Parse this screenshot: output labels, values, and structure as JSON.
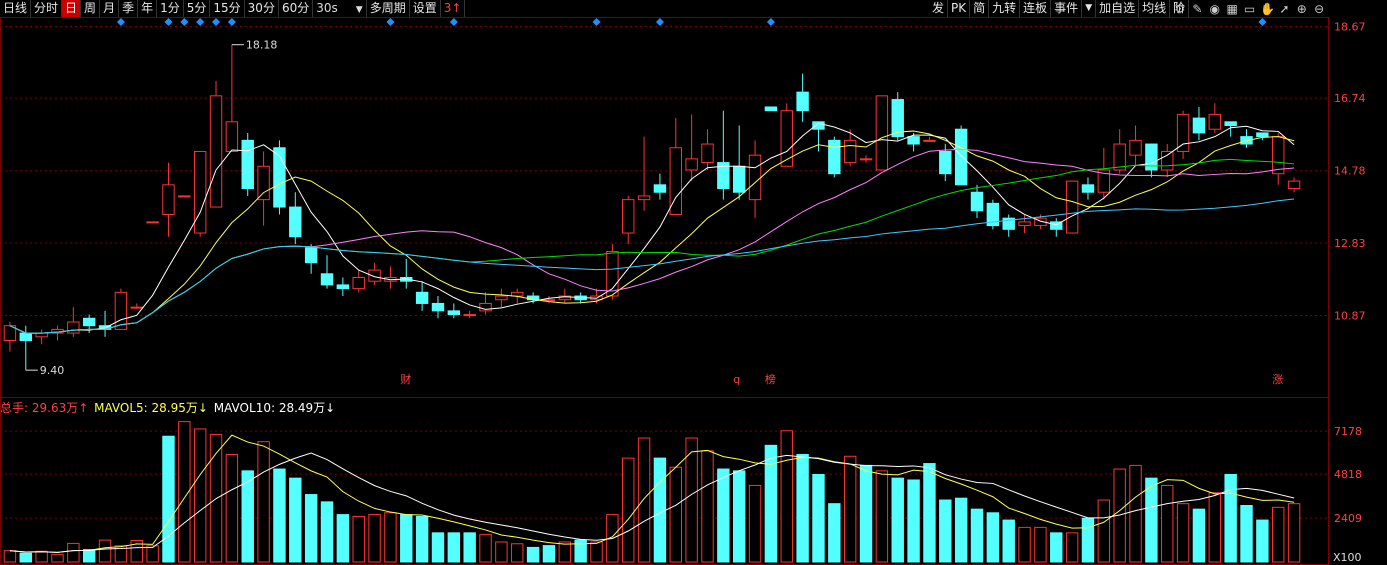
{
  "toolbar": {
    "items": [
      {
        "label": "日线",
        "state": "normal"
      },
      {
        "label": "分时",
        "state": "normal"
      },
      {
        "label": "日",
        "state": "active"
      },
      {
        "label": "周",
        "state": "normal"
      },
      {
        "label": "月",
        "state": "normal"
      },
      {
        "label": "季",
        "state": "normal"
      },
      {
        "label": "年",
        "state": "normal"
      },
      {
        "label": "1分",
        "state": "normal"
      },
      {
        "label": "5分",
        "state": "normal"
      },
      {
        "label": "15分",
        "state": "normal"
      },
      {
        "label": "30分",
        "state": "normal"
      },
      {
        "label": "60分",
        "state": "normal"
      }
    ],
    "period_select": "30s",
    "multi_period": "多周期",
    "settings": "设置",
    "alert": "3↑",
    "right_items": [
      "发",
      "PK",
      "简",
      "九转",
      "连板",
      "事件"
    ],
    "add_watch": "加自选",
    "ma_line": "均线",
    "cut_label": "阶",
    "icons": [
      "settings-icon",
      "brush-icon",
      "eye-icon",
      "calendar-icon",
      "display-icon",
      "hand-icon",
      "cursor-icon",
      "zoom-in-icon",
      "zoom-out-icon"
    ]
  },
  "price_axis": {
    "ticks": [
      "18.67",
      "16.74",
      "14.78",
      "12.83",
      "10.87"
    ]
  },
  "volume_axis": {
    "ticks": [
      "7178",
      "4818",
      "2409"
    ],
    "unit": "X100"
  },
  "annotations": {
    "high": "18.18",
    "low": "9.40"
  },
  "event_markers": [
    {
      "label": "财",
      "index": 25
    },
    {
      "label": "q",
      "index": 46
    },
    {
      "label": "榜",
      "index": 48
    },
    {
      "label": "涨",
      "index": 80
    }
  ],
  "volume_info": {
    "total": "总手: 29.63万↑",
    "mavol5": "MAVOL5: 28.95万↓",
    "mavol10": "MAVOL10: 28.49万↓"
  },
  "colors": {
    "up": "#ff3232",
    "down": "#54ffff",
    "ma5": "#ffffff",
    "ma10": "#ffff4c",
    "ma20": "#ff80ff",
    "ma30": "#00e000",
    "ma60": "#40c8ff",
    "grid": "#7a0000",
    "axis_text": "#ff4040",
    "marker": "#1e90ff"
  },
  "chart_data": {
    "type": "candlestick",
    "price_range": [
      9.0,
      18.9
    ],
    "volume_max": 7900,
    "candles": [
      [
        10.2,
        10.6,
        10.7,
        9.9
      ],
      [
        10.4,
        10.2,
        10.6,
        9.4
      ],
      [
        10.3,
        10.4,
        10.5,
        10.1
      ],
      [
        10.4,
        10.5,
        10.6,
        10.2
      ],
      [
        10.4,
        10.7,
        11.1,
        10.3
      ],
      [
        10.8,
        10.6,
        10.9,
        10.4
      ],
      [
        10.6,
        10.5,
        11.0,
        10.3
      ],
      [
        10.5,
        11.5,
        11.6,
        10.5
      ],
      [
        11.1,
        11.1,
        11.2,
        11.1
      ],
      [
        13.4,
        13.4,
        13.4,
        13.4
      ],
      [
        13.6,
        14.4,
        15.0,
        13.0
      ],
      [
        14.1,
        14.1,
        14.1,
        14.1
      ],
      [
        13.1,
        15.3,
        15.3,
        13.0
      ],
      [
        13.8,
        16.8,
        17.2,
        13.8
      ],
      [
        15.3,
        16.1,
        18.18,
        15.3
      ],
      [
        15.6,
        14.3,
        15.8,
        14.1
      ],
      [
        14.0,
        14.9,
        15.3,
        13.3
      ],
      [
        15.4,
        13.8,
        15.6,
        13.6
      ],
      [
        13.8,
        13.0,
        14.2,
        12.8
      ],
      [
        12.7,
        12.3,
        12.8,
        12.0
      ],
      [
        12.0,
        11.7,
        12.5,
        11.6
      ],
      [
        11.7,
        11.6,
        11.9,
        11.4
      ],
      [
        11.6,
        11.9,
        12.1,
        11.5
      ],
      [
        11.8,
        12.1,
        12.3,
        11.7
      ],
      [
        11.8,
        11.9,
        12.2,
        11.6
      ],
      [
        11.9,
        11.8,
        12.4,
        11.6
      ],
      [
        11.5,
        11.2,
        11.8,
        11.0
      ],
      [
        11.2,
        11.0,
        11.4,
        10.8
      ],
      [
        11.0,
        10.9,
        11.2,
        10.8
      ],
      [
        10.9,
        10.9,
        11.0,
        10.8
      ],
      [
        11.0,
        11.2,
        11.5,
        10.9
      ],
      [
        11.3,
        11.4,
        11.6,
        11.1
      ],
      [
        11.4,
        11.5,
        11.6,
        11.2
      ],
      [
        11.4,
        11.3,
        11.5,
        11.2
      ],
      [
        11.3,
        11.3,
        11.4,
        11.2
      ],
      [
        11.3,
        11.4,
        11.6,
        11.2
      ],
      [
        11.4,
        11.3,
        11.5,
        11.2
      ],
      [
        11.3,
        11.4,
        11.6,
        11.2
      ],
      [
        11.4,
        12.6,
        12.8,
        11.3
      ],
      [
        13.1,
        14.0,
        14.1,
        12.8
      ],
      [
        14.0,
        14.1,
        15.7,
        13.7
      ],
      [
        14.4,
        14.2,
        14.7,
        14.0
      ],
      [
        13.6,
        15.4,
        16.2,
        13.6
      ],
      [
        14.8,
        15.1,
        16.3,
        14.5
      ],
      [
        15.0,
        15.5,
        15.9,
        14.8
      ],
      [
        15.0,
        14.3,
        16.4,
        14.0
      ],
      [
        14.9,
        14.2,
        16.0,
        14.0
      ],
      [
        14.0,
        15.2,
        15.6,
        13.5
      ],
      [
        16.5,
        16.4,
        16.5,
        16.4
      ],
      [
        14.9,
        16.4,
        16.6,
        14.9
      ],
      [
        16.9,
        16.4,
        17.4,
        16.1
      ],
      [
        16.1,
        15.9,
        16.1,
        15.3
      ],
      [
        15.6,
        14.7,
        15.7,
        14.6
      ],
      [
        15.0,
        15.6,
        15.9,
        14.9
      ],
      [
        15.1,
        15.1,
        15.2,
        15.0
      ],
      [
        14.8,
        16.8,
        16.8,
        14.8
      ],
      [
        16.7,
        15.7,
        16.9,
        15.6
      ],
      [
        15.7,
        15.5,
        15.8,
        15.3
      ],
      [
        15.6,
        15.6,
        15.7,
        15.6
      ],
      [
        15.3,
        14.7,
        15.5,
        14.5
      ],
      [
        15.9,
        14.4,
        16.0,
        14.4
      ],
      [
        14.2,
        13.7,
        14.4,
        13.5
      ],
      [
        13.9,
        13.3,
        14.0,
        13.2
      ],
      [
        13.5,
        13.2,
        13.6,
        13.0
      ],
      [
        13.3,
        13.4,
        13.6,
        13.1
      ],
      [
        13.3,
        13.5,
        13.6,
        13.2
      ],
      [
        13.4,
        13.2,
        13.5,
        13.0
      ],
      [
        13.1,
        14.5,
        14.5,
        13.1
      ],
      [
        14.4,
        14.2,
        14.6,
        14.0
      ],
      [
        14.2,
        14.8,
        15.4,
        14.0
      ],
      [
        14.8,
        15.5,
        15.9,
        14.7
      ],
      [
        15.2,
        15.6,
        16.0,
        14.9
      ],
      [
        15.5,
        14.8,
        15.5,
        14.6
      ],
      [
        14.8,
        15.3,
        15.5,
        14.6
      ],
      [
        15.3,
        16.3,
        16.4,
        15.1
      ],
      [
        16.2,
        15.8,
        16.5,
        15.6
      ],
      [
        15.9,
        16.3,
        16.6,
        15.8
      ],
      [
        16.1,
        16.0,
        16.1,
        15.7
      ],
      [
        15.7,
        15.5,
        15.9,
        15.4
      ],
      [
        15.8,
        15.7,
        15.8,
        15.6
      ],
      [
        14.7,
        15.7,
        15.8,
        14.4
      ],
      [
        14.3,
        14.5,
        14.6,
        14.2
      ]
    ],
    "volumes": [
      620,
      480,
      590,
      420,
      1020,
      680,
      1200,
      890,
      1180,
      890,
      6900,
      7700,
      7300,
      7000,
      5900,
      5000,
      6600,
      5100,
      4600,
      3700,
      3300,
      2600,
      2500,
      2600,
      2700,
      2600,
      2500,
      1600,
      1600,
      1600,
      1500,
      1100,
      1000,
      800,
      900,
      1100,
      1200,
      1100,
      2600,
      5700,
      6800,
      5700,
      5200,
      6800,
      6100,
      5100,
      5000,
      4200,
      6400,
      7200,
      5900,
      4800,
      3200,
      5800,
      5300,
      5000,
      4600,
      4500,
      5400,
      3400,
      3500,
      2900,
      2700,
      2300,
      1900,
      1900,
      1600,
      1600,
      2400,
      3400,
      5100,
      5300,
      4600,
      4200,
      3200,
      2900,
      3800,
      4800,
      3100,
      2300,
      3000,
      3200
    ],
    "volume_up": [
      true,
      false,
      true,
      true,
      true,
      false,
      true,
      true,
      true,
      true,
      false,
      true,
      true,
      true,
      true,
      false,
      true,
      false,
      false,
      false,
      false,
      false,
      true,
      true,
      true,
      false,
      false,
      false,
      false,
      false,
      true,
      true,
      true,
      false,
      false,
      true,
      false,
      true,
      true,
      true,
      true,
      false,
      true,
      true,
      true,
      false,
      false,
      true,
      false,
      true,
      false,
      false,
      false,
      true,
      false,
      true,
      false,
      false,
      false,
      false,
      false,
      false,
      false,
      false,
      true,
      true,
      false,
      true,
      false,
      true,
      true,
      true,
      false,
      true,
      true,
      false,
      true,
      false,
      false,
      false,
      true,
      true
    ]
  }
}
